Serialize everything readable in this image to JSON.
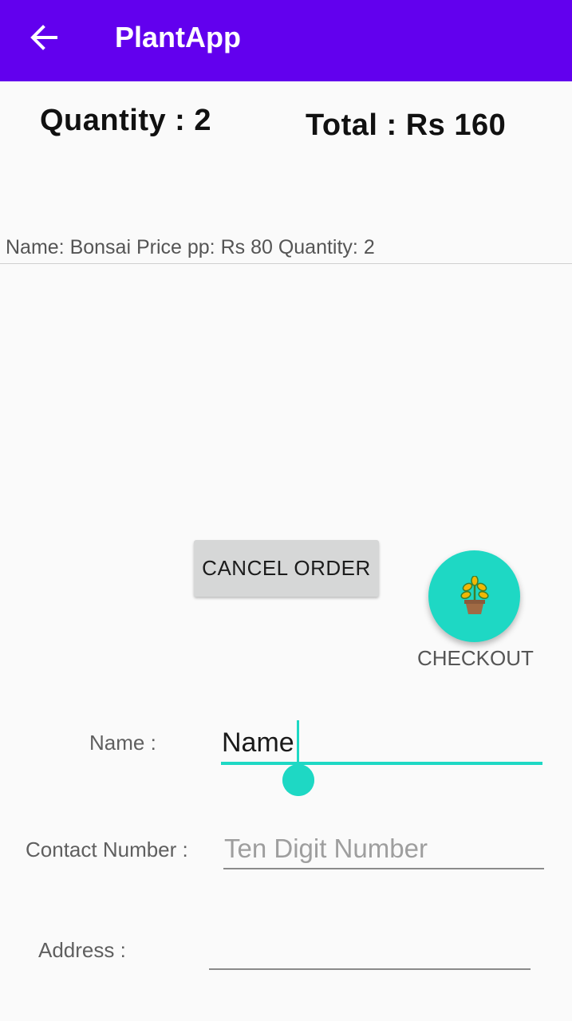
{
  "appbar": {
    "title": "PlantApp",
    "back_icon": "arrow-left-icon",
    "color": "#6200ee"
  },
  "summary": {
    "quantity_text": "Quantity : 2",
    "total_text": "Total : Rs 160"
  },
  "order_items": [
    {
      "text": "Name: Bonsai Price pp: Rs 80 Quantity: 2"
    }
  ],
  "buttons": {
    "cancel_label": "CANCEL ORDER",
    "checkout_label": "CHECKOUT",
    "checkout_icon": "potted-plant-icon",
    "accent": "#1ed8c4"
  },
  "form": {
    "name": {
      "label": "Name :",
      "value": "Name"
    },
    "contact": {
      "label": "Contact Number :",
      "placeholder": "Ten Digit Number",
      "value": ""
    },
    "address": {
      "label": "Address :",
      "value": ""
    }
  }
}
